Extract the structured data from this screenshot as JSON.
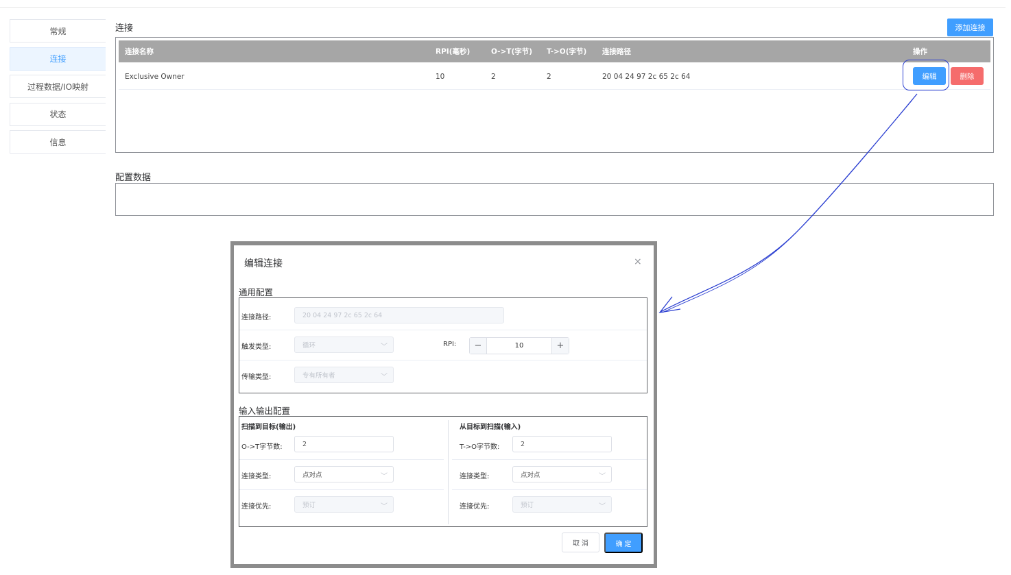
{
  "sidebar": {
    "items": [
      {
        "label": "常规"
      },
      {
        "label": "连接",
        "active": true
      },
      {
        "label": "过程数据/IO映射"
      },
      {
        "label": "状态"
      },
      {
        "label": "信息"
      }
    ]
  },
  "connections": {
    "title": "连接",
    "add_label": "添加连接",
    "columns": [
      "连接名称",
      "RPI(毫秒)",
      "O->T(字节)",
      "T->O(字节)",
      "连接路径",
      "操作"
    ],
    "rows": [
      {
        "name": "Exclusive Owner",
        "rpi": "10",
        "ot": "2",
        "to": "2",
        "path": "20 04 24 97 2c 65 2c 64",
        "edit_label": "编辑",
        "delete_label": "删除"
      }
    ]
  },
  "config_data": {
    "title": "配置数据"
  },
  "dialog": {
    "title": "编辑连接",
    "close_glyph": "×",
    "general": {
      "title": "通用配置",
      "path_label": "连接路径:",
      "path_value": "20 04 24 97 2c 65 2c 64",
      "trigger_label": "触发类型:",
      "trigger_value": "循环",
      "rpi_label": "RPI:",
      "rpi_value": "10",
      "minus_glyph": "−",
      "plus_glyph": "+",
      "transport_label": "传输类型:",
      "transport_value": "专有所有者"
    },
    "io": {
      "title": "输入输出配置",
      "output": {
        "heading": "扫描到目标(输出)",
        "size_label": "O->T字节数:",
        "size_value": "2",
        "type_label": "连接类型:",
        "type_value": "点对点",
        "priority_label": "连接优先:",
        "priority_value": "预订"
      },
      "input": {
        "heading": "从目标到扫描(输入)",
        "size_label": "T->O字节数:",
        "size_value": "2",
        "type_label": "连接类型:",
        "type_value": "点对点",
        "priority_label": "连接优先:",
        "priority_value": "预订"
      }
    },
    "cancel_label": "取 消",
    "ok_label": "确 定"
  },
  "colors": {
    "primary": "#409eff",
    "danger": "#f56c6c",
    "annotation": "#2b3fd1"
  }
}
